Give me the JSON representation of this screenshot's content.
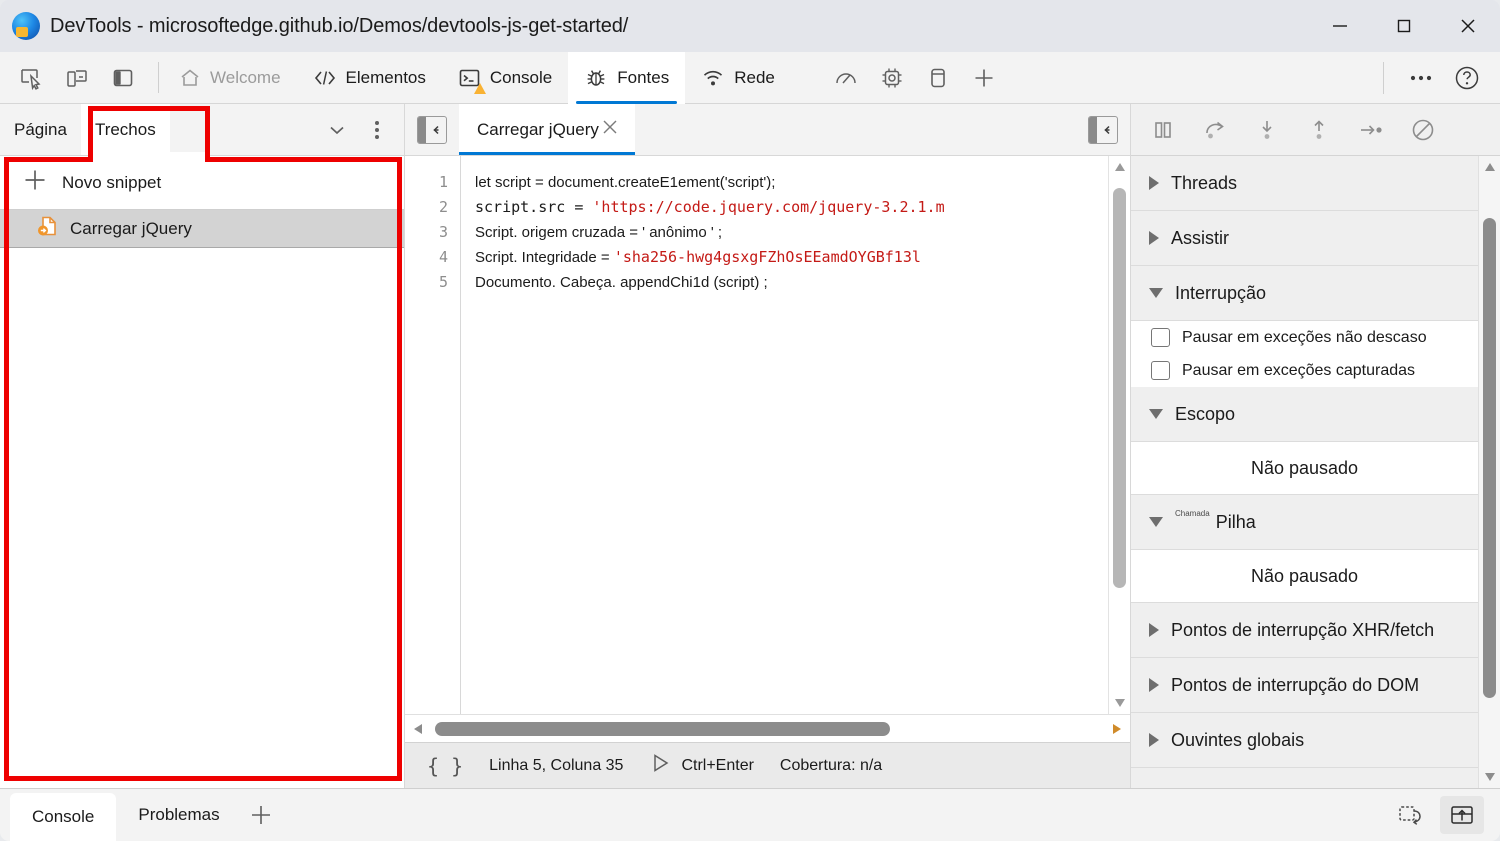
{
  "window": {
    "title": "DevTools - microsoftedge.github.io/Demos/devtools-js-get-started/",
    "app_icon": "edge-devtools-icon",
    "controls": [
      {
        "name": "minimize-button",
        "label": "—"
      },
      {
        "name": "maximize-button",
        "label": "□"
      },
      {
        "name": "close-button",
        "label": "×"
      }
    ]
  },
  "toolbar": {
    "left_icons": [
      {
        "name": "inspect-element-icon",
        "label": "Inspecionar"
      },
      {
        "name": "device-emulation-icon",
        "label": "Emulação de dispositivo"
      },
      {
        "name": "dock-side-icon",
        "label": "Personalizar local de encaixe"
      }
    ],
    "tabs": [
      {
        "name": "tab-welcome",
        "label": "Welcome",
        "icon": "home-icon",
        "active": false,
        "dim": true
      },
      {
        "name": "tab-elementos",
        "label": "Elementos",
        "icon": "code-brackets-icon",
        "active": false
      },
      {
        "name": "tab-console",
        "label": "Console",
        "icon": "console-terminal-icon",
        "active": false,
        "badge": "warning-triangle-icon"
      },
      {
        "name": "tab-fontes",
        "label": "Fontes",
        "icon": "bug-icon",
        "active": true
      },
      {
        "name": "tab-rede",
        "label": "Rede",
        "icon": "network-wifi-icon",
        "active": false
      }
    ],
    "extra_icons": [
      {
        "name": "performance-icon",
        "label": "Desempenho"
      },
      {
        "name": "memory-chip-icon",
        "label": "Memória"
      },
      {
        "name": "application-storage-icon",
        "label": "Aplicativo"
      },
      {
        "name": "add-tab-icon",
        "label": "Mais ferramentas"
      }
    ],
    "right_icons": [
      {
        "name": "more-options-icon",
        "label": "Personalizar e controlar o DevTools"
      },
      {
        "name": "help-icon",
        "label": "Ajuda"
      }
    ]
  },
  "navigator": {
    "tabs": [
      {
        "name": "nav-tab-pagina",
        "label": "Página",
        "active": false
      },
      {
        "name": "nav-tab-trechos",
        "label": "Trechos",
        "active": true
      }
    ],
    "header_icons": [
      {
        "name": "chevron-down-icon",
        "label": "Mais guias"
      },
      {
        "name": "kebab-menu-icon",
        "label": "Mais opções"
      }
    ],
    "new_snippet": {
      "label": "Novo snippet",
      "icon": "plus-icon"
    },
    "snippets": [
      {
        "name": "snippet-item",
        "label": "Carregar jQuery",
        "icon": "snippet-file-icon",
        "selected": true
      }
    ]
  },
  "editor": {
    "back_button": {
      "name": "show-navigator-button",
      "icon": "panel-left-icon"
    },
    "right_button": {
      "name": "show-debugger-button",
      "icon": "panel-right-icon"
    },
    "open_tab": {
      "label": "Carregar jQuery",
      "close_icon": "close-icon",
      "active": true
    },
    "line_numbers": [
      1,
      2,
      3,
      4,
      5
    ],
    "code_lines": [
      {
        "n": 1,
        "mono": false,
        "parts": [
          {
            "t": "let script = document.createE1ement('script');",
            "c": "plain"
          }
        ]
      },
      {
        "n": 2,
        "mono": true,
        "parts": [
          {
            "t": "script.src = ",
            "c": "plain"
          },
          {
            "t": "'https://code.jquery.com/jquery-3.2.1.m",
            "c": "string"
          }
        ]
      },
      {
        "n": 3,
        "mono": false,
        "parts": [
          {
            "t": "Script. origem cruzada     =  ",
            "c": "plain"
          },
          {
            "t": "' anônimo '",
            "c": "plain"
          },
          {
            "t": "    ;",
            "c": "plain"
          }
        ]
      },
      {
        "n": 4,
        "mono": false,
        "parts": [
          {
            "t": "Script. Integridade         =  ",
            "c": "plain"
          },
          {
            "t": "'sha256-hwg4gsxgFZhOsEEamdOYGBf13l",
            "c": "string"
          }
        ]
      },
      {
        "n": 5,
        "mono": false,
        "parts": [
          {
            "t": "Documento. Cabeça. appendChi1d (script) ;",
            "c": "plain"
          }
        ]
      }
    ]
  },
  "status_bar": {
    "pretty_print": {
      "name": "pretty-print-button",
      "label": "{ }"
    },
    "cursor_position": "Linha 5, Coluna 35",
    "run_shortcut": {
      "icon": "play-icon",
      "label": "Ctrl+Enter"
    },
    "coverage": "Cobertura: n/a"
  },
  "debugger": {
    "controls": [
      {
        "name": "pause-resume-button",
        "icon": "pause-icon",
        "label": "Pausar script"
      },
      {
        "name": "step-over-button",
        "icon": "step-over-icon",
        "label": "Ir para a próxima chamada de função"
      },
      {
        "name": "step-into-button",
        "icon": "step-into-icon",
        "label": "Entrar na próxima chamada de função"
      },
      {
        "name": "step-out-button",
        "icon": "step-out-icon",
        "label": "Sair da chamada de função atual"
      },
      {
        "name": "step-button",
        "icon": "step-icon",
        "label": "Etapa"
      },
      {
        "name": "deactivate-breakpoints-button",
        "icon": "no-breakpoints-icon",
        "label": "Desativar pontos de interrupção"
      }
    ],
    "sections": [
      {
        "name": "section-threads",
        "label": "Threads",
        "expanded": false
      },
      {
        "name": "section-assistir",
        "label": "Assistir",
        "expanded": false
      },
      {
        "name": "section-interrupcao",
        "label": "Interrupção",
        "expanded": true
      },
      {
        "name": "section-escopo",
        "label": "Escopo",
        "expanded": true
      },
      {
        "name": "section-pilha-chamada",
        "label": "Pilha",
        "superscript": "Chamada",
        "expanded": true
      },
      {
        "name": "section-xhr-fetch-breakpoints",
        "label": "Pontos de interrupção XHR/fetch",
        "expanded": false
      },
      {
        "name": "section-dom-breakpoints",
        "label": "Pontos de interrupção do DOM",
        "expanded": false
      },
      {
        "name": "section-ouvintes-globais",
        "label": "Ouvintes globais",
        "expanded": false
      }
    ],
    "breakpoint_checkboxes": [
      {
        "name": "pause-uncaught-exceptions-checkbox",
        "label": "Pausar em exceções não descaso",
        "checked": false
      },
      {
        "name": "pause-caught-exceptions-checkbox",
        "label": "Pausar em exceções capturadas",
        "checked": false
      }
    ],
    "empty_state": "Não pausado"
  },
  "drawer": {
    "tabs": [
      {
        "name": "drawer-tab-console",
        "label": "Console",
        "active": true
      },
      {
        "name": "drawer-tab-problemas",
        "label": "Problemas",
        "active": false
      }
    ],
    "add_icon": "plus-icon",
    "right_icons": [
      {
        "name": "restore-drawer-icon",
        "label": "Restaurar"
      },
      {
        "name": "expand-drawer-icon",
        "label": "Expandir"
      }
    ]
  },
  "annotations": {
    "accent_color": "#ee0000",
    "boxes": [
      {
        "name": "annotation-trechos-tab",
        "target": "Trechos"
      },
      {
        "name": "annotation-snippets-panel",
        "target": "Painel de trechos"
      }
    ]
  }
}
